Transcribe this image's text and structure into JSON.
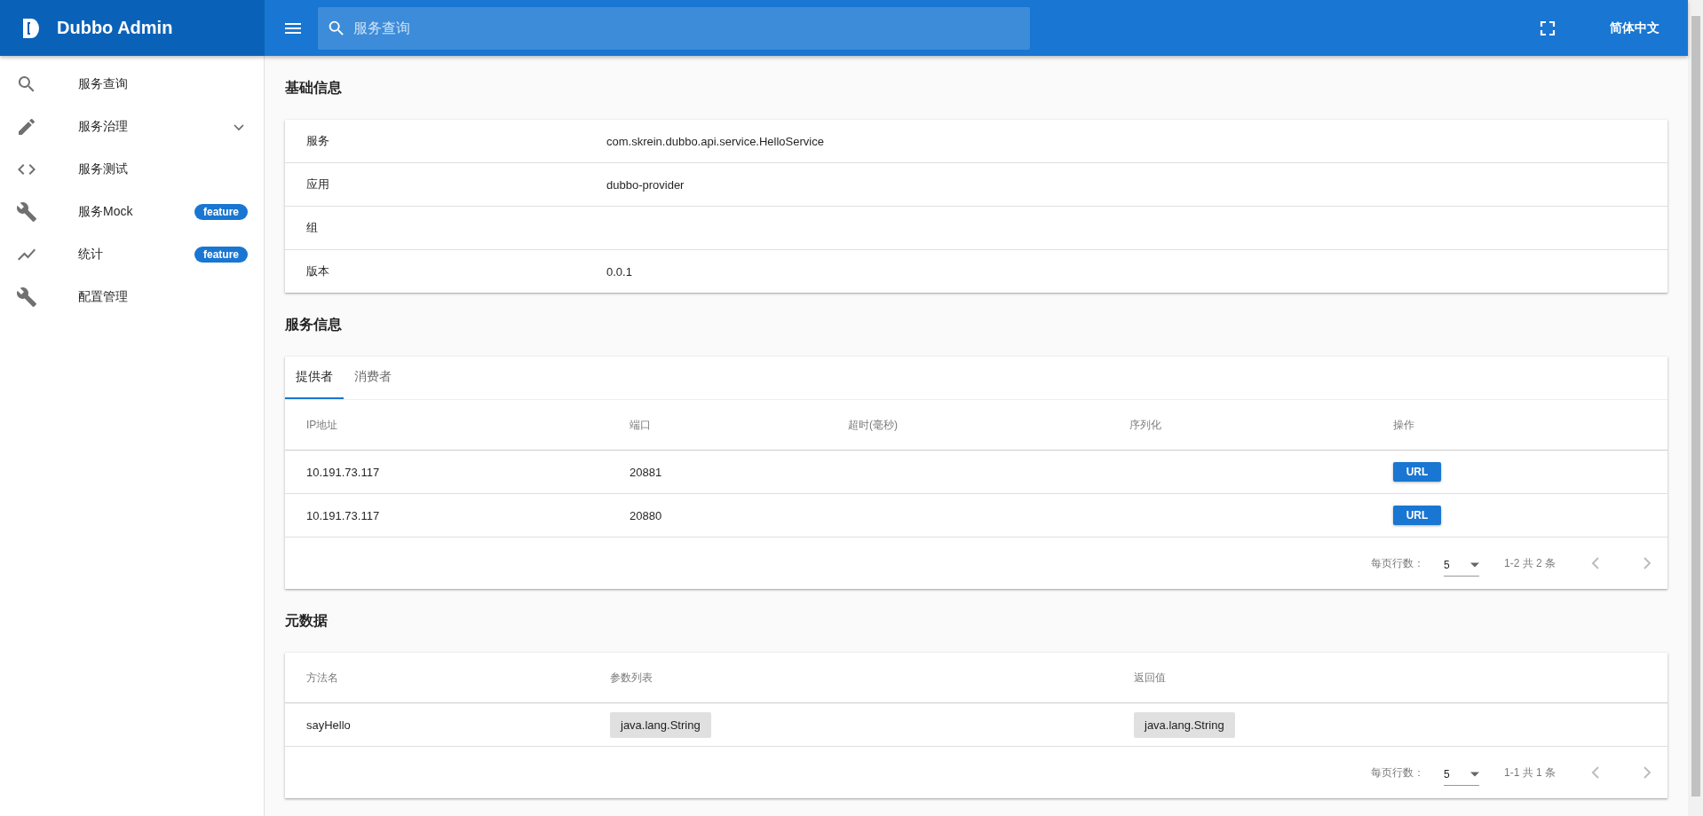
{
  "header": {
    "title": "Dubbo Admin",
    "search": {
      "placeholder": "服务查询"
    },
    "language": "简体中文"
  },
  "sidebar": {
    "items": [
      {
        "label": "服务查询",
        "kind": "search"
      },
      {
        "label": "服务治理",
        "kind": "pencil",
        "expanded": false
      },
      {
        "label": "服务测试",
        "kind": "code"
      },
      {
        "label": "服务Mock",
        "kind": "wrench",
        "badge": "feature"
      },
      {
        "label": "统计",
        "kind": "chart",
        "badge": "feature"
      },
      {
        "label": "配置管理",
        "kind": "wrench"
      }
    ]
  },
  "basic_info": {
    "title": "基础信息",
    "rows": [
      {
        "label": "服务",
        "value": "com.skrein.dubbo.api.service.HelloService"
      },
      {
        "label": "应用",
        "value": "dubbo-provider"
      },
      {
        "label": "组"
      },
      {
        "label": "版本",
        "value": "0.0.1"
      }
    ]
  },
  "service_info": {
    "title": "服务信息",
    "tabs": [
      {
        "label": "提供者",
        "selected": true
      },
      {
        "label": "消费者",
        "selected": false
      }
    ],
    "table": {
      "columns": [
        "IP地址",
        "端口",
        "超时(毫秒)",
        "序列化",
        "操作"
      ],
      "rows": [
        {
          "ip": "10.191.73.117",
          "port": "20881",
          "action": "URL"
        },
        {
          "ip": "10.191.73.117",
          "port": "20880",
          "action": "URL"
        }
      ]
    },
    "pagination": {
      "rows_per_page_label": "每页行数：",
      "rows_per_page": "5",
      "range": "1-2 共 2 条"
    }
  },
  "metadata": {
    "title": "元数据",
    "table": {
      "columns": [
        "方法名",
        "参数列表",
        "返回值"
      ],
      "rows": [
        {
          "method": "sayHello",
          "params": [
            "java.lang.String"
          ],
          "returns": "java.lang.String"
        }
      ]
    },
    "pagination": {
      "rows_per_page_label": "每页行数：",
      "rows_per_page": "5",
      "range": "1-1 共 1 条"
    }
  }
}
